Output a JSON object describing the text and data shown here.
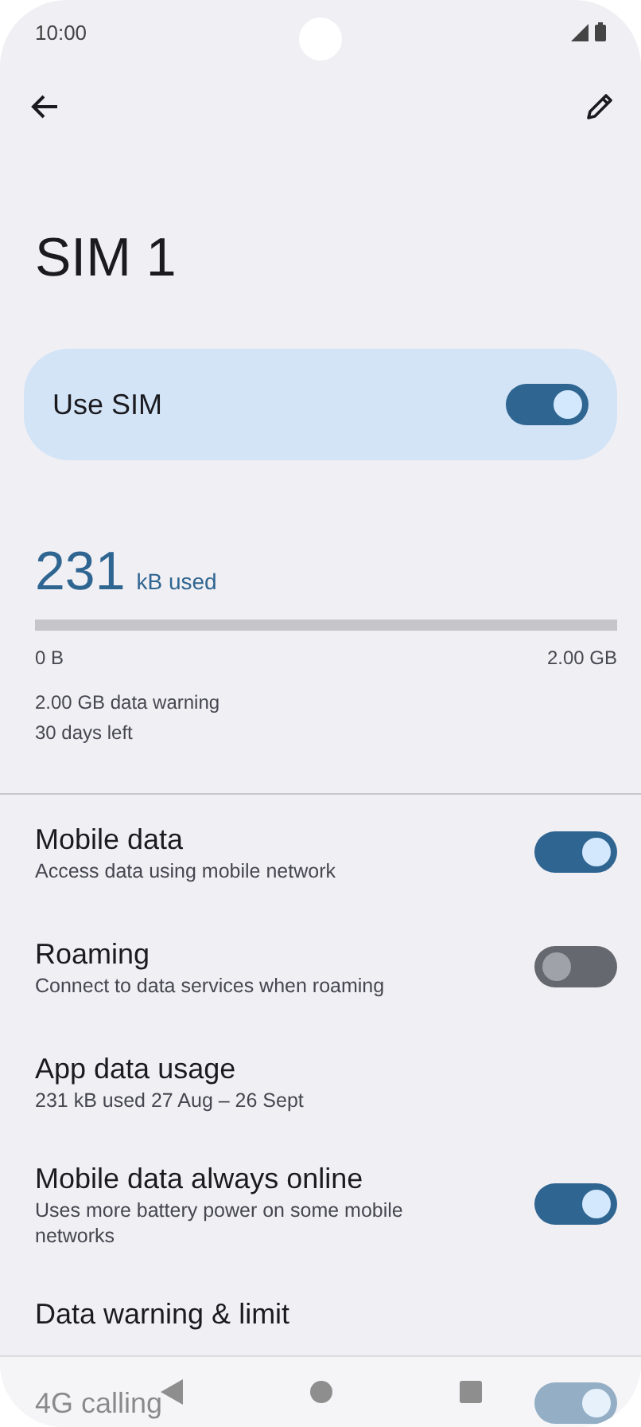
{
  "status_bar": {
    "time": "10:00"
  },
  "title": "SIM 1",
  "use_sim": {
    "label": "Use SIM",
    "on": true
  },
  "usage": {
    "amount": "231",
    "unit": "kB used",
    "min_label": "0 B",
    "max_label": "2.00 GB",
    "warning": "2.00 GB data warning",
    "days_left": "30 days left"
  },
  "settings": [
    {
      "kind": "toggle",
      "title": "Mobile data",
      "subtitle": "Access data using mobile network",
      "on": true
    },
    {
      "kind": "toggle",
      "title": "Roaming",
      "subtitle": "Connect to data services when roaming",
      "on": false
    },
    {
      "kind": "link",
      "title": "App data usage",
      "subtitle": "231 kB used 27 Aug – 26 Sept"
    },
    {
      "kind": "toggle",
      "title": "Mobile data always online",
      "subtitle": "Uses more battery power on some mobile networks",
      "on": true
    },
    {
      "kind": "link",
      "title": "Data warning & limit"
    },
    {
      "kind": "toggle",
      "title": "4G calling",
      "on": true
    }
  ]
}
